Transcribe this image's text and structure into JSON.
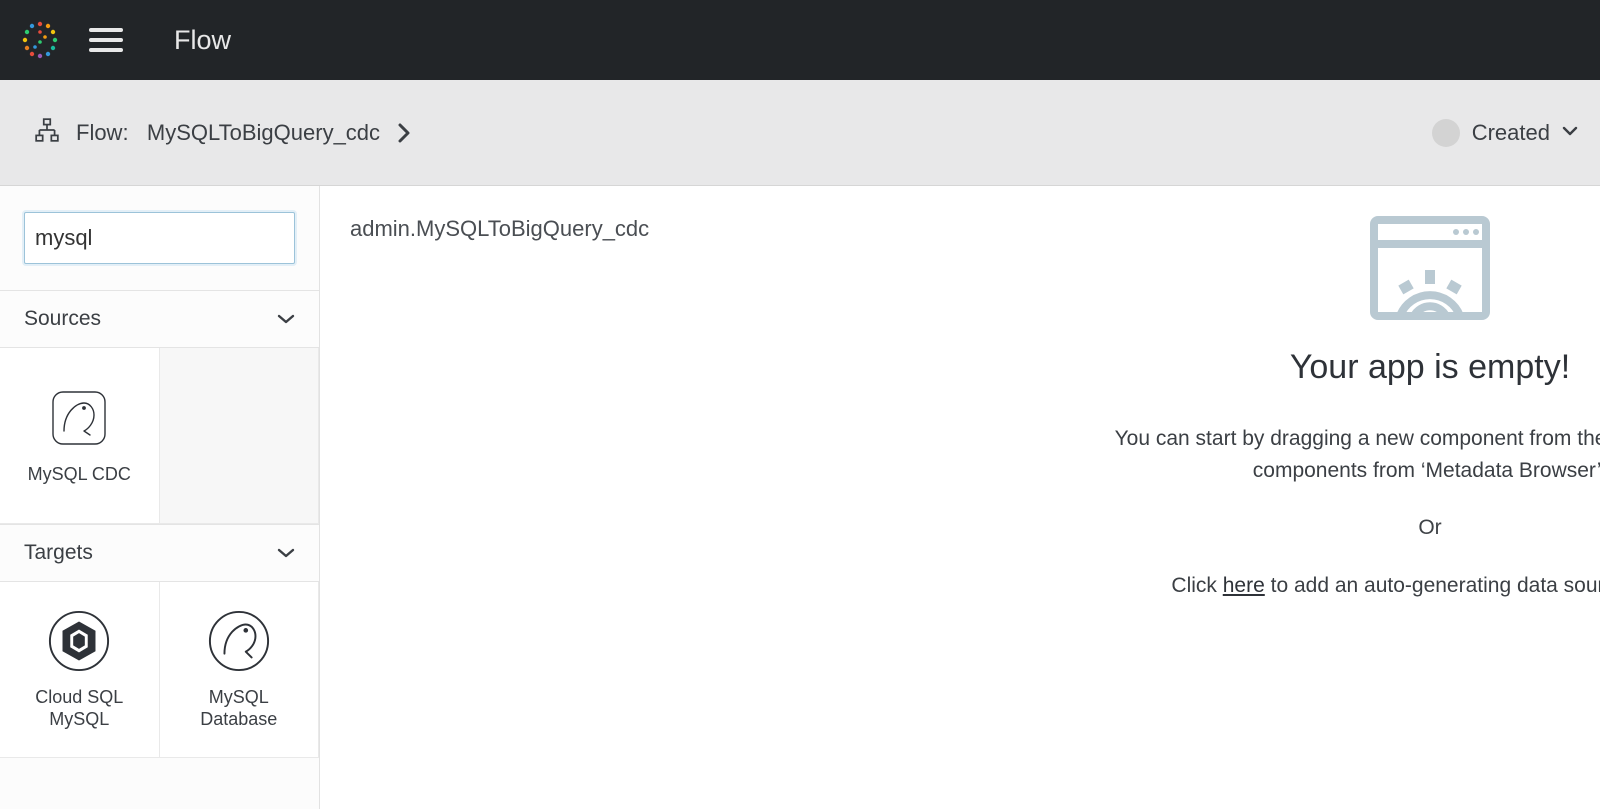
{
  "topbar": {
    "title": "Flow"
  },
  "strip": {
    "prefix": "Flow:",
    "name": "MySQLToBigQuery_cdc",
    "status": "Created"
  },
  "sidebar": {
    "search_value": "mysql",
    "sections": {
      "sources": {
        "label": "Sources",
        "items": [
          {
            "label": "MySQL CDC"
          }
        ]
      },
      "targets": {
        "label": "Targets",
        "items": [
          {
            "label": "Cloud SQL\nMySQL"
          },
          {
            "label": "MySQL\nDatabase"
          }
        ]
      }
    }
  },
  "canvas": {
    "title": "admin.MySQLToBigQuery_cdc",
    "empty": {
      "heading": "Your app is empty!",
      "line1": "You can start by dragging a new component from the sidebar on the left, or existing components from ‘Metadata Browser’.",
      "line1_visible_a": "You can start by dragging a new component from the sidebar on the",
      "line1_visible_b": "components from ‘Metadata Browser’.",
      "or": "Or",
      "click_prefix": "Click ",
      "click_link": "here",
      "click_suffix": " to add an auto-generating data source to this "
    }
  }
}
